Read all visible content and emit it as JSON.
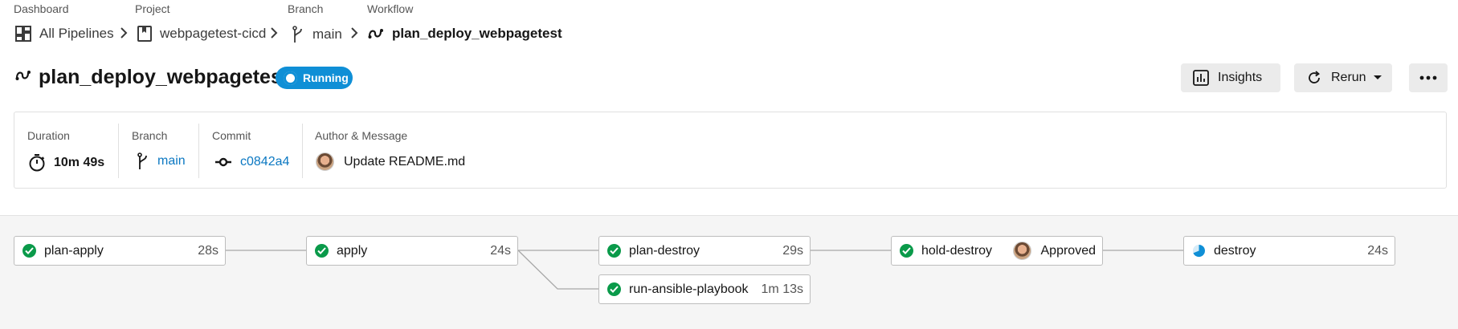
{
  "breadcrumb": {
    "dashboard": {
      "caption": "Dashboard",
      "label": "All Pipelines"
    },
    "project": {
      "caption": "Project",
      "label": "webpagetest-cicd"
    },
    "branch": {
      "caption": "Branch",
      "label": "main"
    },
    "workflow": {
      "caption": "Workflow",
      "label": "plan_deploy_webpagetest"
    }
  },
  "header": {
    "title": "plan_deploy_webpagetest",
    "status": "Running",
    "insights_label": "Insights",
    "rerun_label": "Rerun"
  },
  "summary": {
    "duration": {
      "label": "Duration",
      "value": "10m 49s"
    },
    "branch": {
      "label": "Branch",
      "value": "main"
    },
    "commit": {
      "label": "Commit",
      "value": "c0842a4"
    },
    "author": {
      "label": "Author & Message",
      "message": "Update README.md"
    }
  },
  "jobs": [
    {
      "name": "plan-apply",
      "duration": "28s",
      "status": "success"
    },
    {
      "name": "apply",
      "duration": "24s",
      "status": "success"
    },
    {
      "name": "plan-destroy",
      "duration": "29s",
      "status": "success"
    },
    {
      "name": "run-ansible-playbook",
      "duration": "1m 13s",
      "status": "success"
    },
    {
      "name": "hold-destroy",
      "approval": "Approved",
      "status": "success"
    },
    {
      "name": "destroy",
      "duration": "24s",
      "status": "running"
    }
  ],
  "colors": {
    "accent": "#0f8fd6",
    "success": "#0a9a4a",
    "link": "#0b78c2"
  }
}
